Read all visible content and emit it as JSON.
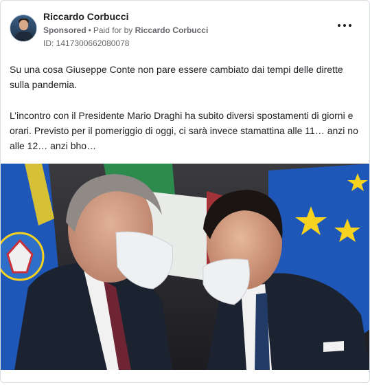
{
  "ad": {
    "advertiser_name": "Riccardo Corbucci",
    "sponsored_label": "Sponsored",
    "separator": "•",
    "paid_for_prefix": "Paid for by",
    "paid_for_name": "Riccardo Corbucci",
    "ad_id": "ID: 1417300662080078",
    "more_icon": "more-horizontal-icon"
  },
  "body": {
    "paragraph_1": "Su una cosa Giuseppe Conte non pare essere cambiato dai tempi delle dirette sulla pandemia.",
    "paragraph_2": "L’incontro con il Presidente Mario Draghi ha subito diversi spostamenti di giorni e orari. Previsto per il pomeriggio di oggi, ci sarà invece stamattina alle 11… anzi no alle 12… anzi bho…",
    "ellipsis": "…"
  },
  "media": {
    "type": "photo",
    "palette": {
      "eu_blue": "#1f57b8",
      "eu_star": "#f7d21e",
      "italy_green": "#2e8b4e",
      "italy_red": "#c8313a",
      "suit": "#1b2230",
      "mask": "#eef0f2"
    }
  }
}
